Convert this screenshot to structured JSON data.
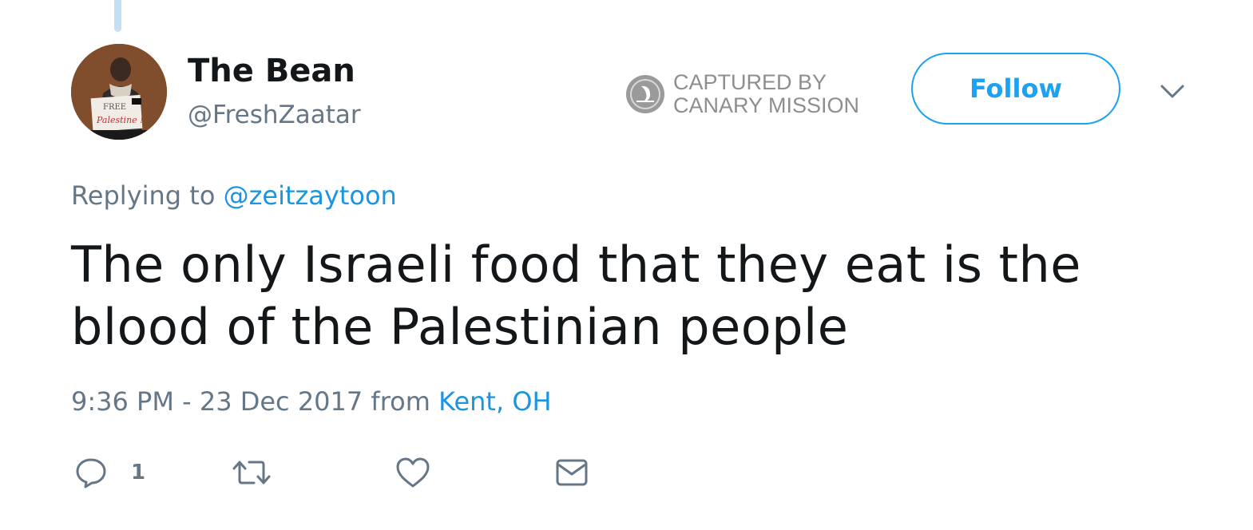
{
  "tweet": {
    "author": {
      "name": "The Bean",
      "handle": "@FreshZaatar",
      "avatar_icon": "profile-photo"
    },
    "watermark": {
      "line1": "CAPTURED BY",
      "line2": "CANARY MISSION",
      "icon": "canary-bird-icon"
    },
    "follow_label": "Follow",
    "menu_icon": "chevron-down-icon",
    "replying": {
      "prefix": "Replying to",
      "to": "@zeitzaytoon"
    },
    "text": "The only Israeli food that they eat is the blood of the Palestinian people",
    "meta": {
      "time": "9:36 PM - 23 Dec 2017",
      "from": "from",
      "location": "Kent, OH"
    },
    "actions": {
      "reply_icon": "reply-icon",
      "reply_count": "1",
      "retweet_icon": "retweet-icon",
      "like_icon": "heart-icon",
      "message_icon": "envelope-icon"
    }
  },
  "colors": {
    "accent": "#1da1f2",
    "link": "#1b95e0",
    "secondary_text": "#657786",
    "primary_text": "#14171a",
    "thread_line": "#c4dff3",
    "watermark": "#8e8e8e"
  }
}
